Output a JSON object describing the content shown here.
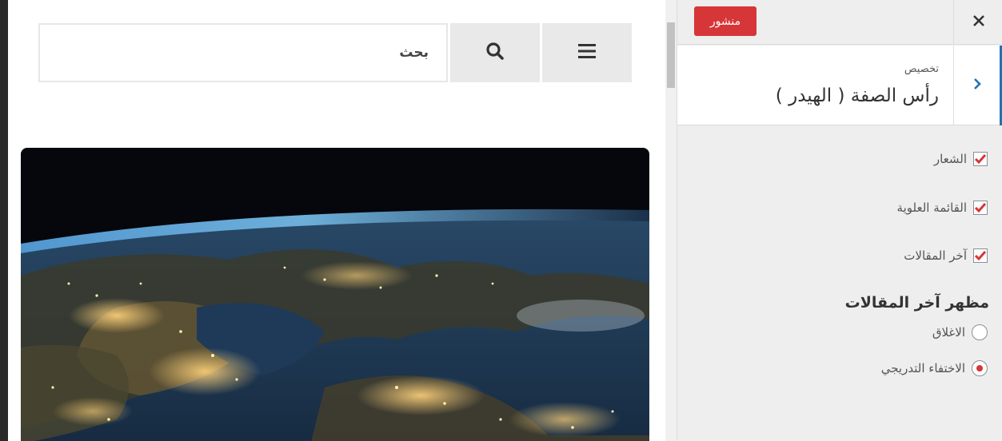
{
  "preview": {
    "search_placeholder": "بحث",
    "icons": {
      "search": "search-icon",
      "menu": "hamburger-menu-icon"
    },
    "hero_image": "earth-at-night-from-space"
  },
  "panel": {
    "close_icon": "close-icon",
    "publish_label": "منشور",
    "back_icon": "chevron-right-icon",
    "section_subtitle": "تخصيص",
    "section_title": "رأس الصفة ( الهيدر )",
    "options": [
      {
        "label": "الشعار",
        "checked": true
      },
      {
        "label": "القائمة العلوية",
        "checked": true
      },
      {
        "label": "آخر المقالات",
        "checked": true
      }
    ],
    "group_title": "مظهر آخر المقالات",
    "radios": [
      {
        "label": "الاغلاق",
        "selected": false
      },
      {
        "label": "الاختفاء التدريجي",
        "selected": true
      }
    ]
  },
  "colors": {
    "accent_red": "#d63638",
    "accent_blue": "#2271b1",
    "check_red": "#d63638"
  }
}
